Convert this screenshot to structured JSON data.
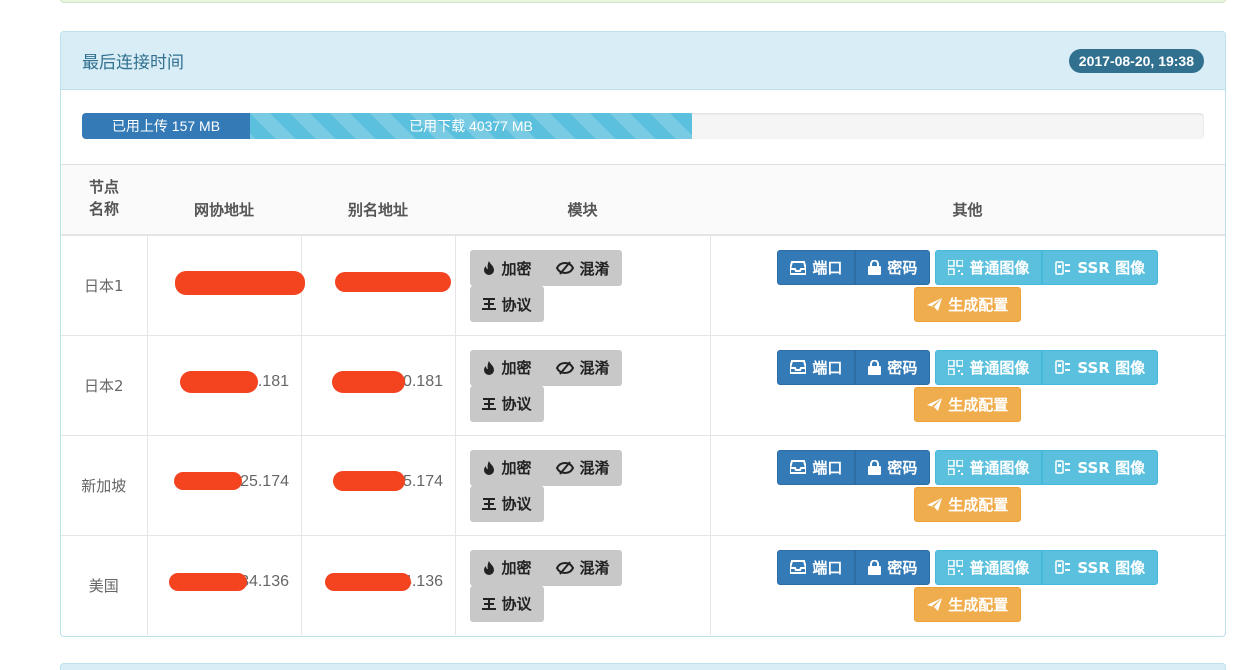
{
  "panel": {
    "title": "最后连接时间",
    "last_time": "2017-08-20, 19:38"
  },
  "traffic": {
    "upload_label": "已用上传 157 MB",
    "download_label": "已用下载 40377 MB"
  },
  "table": {
    "headers": {
      "name": "节点名称",
      "ip": "网协地址",
      "alias": "别名地址",
      "module": "模块",
      "other": "其他"
    },
    "rows": [
      {
        "name": "日本1",
        "ip_visible": "",
        "alias_visible": ""
      },
      {
        "name": "日本2",
        "ip_visible": ".181",
        "alias_visible": "0.181"
      },
      {
        "name": "新加坡",
        "ip_visible": "25.174",
        "alias_visible": "5.174"
      },
      {
        "name": "美国",
        "ip_visible": "34.136",
        "alias_visible": "4.136"
      }
    ]
  },
  "buttons": {
    "encrypt": "加密",
    "obfs": "混淆",
    "protocol": "协议",
    "port": "端口",
    "password": "密码",
    "normal_qr": "普通图像",
    "ssr_qr": "SSR 图像",
    "gen_config": "生成配置"
  },
  "colors": {
    "primary": "#337ab7",
    "info": "#5bc0de",
    "warning": "#f0ad4e",
    "heading_bg": "#d9edf7",
    "redaction": "#f4431f"
  }
}
